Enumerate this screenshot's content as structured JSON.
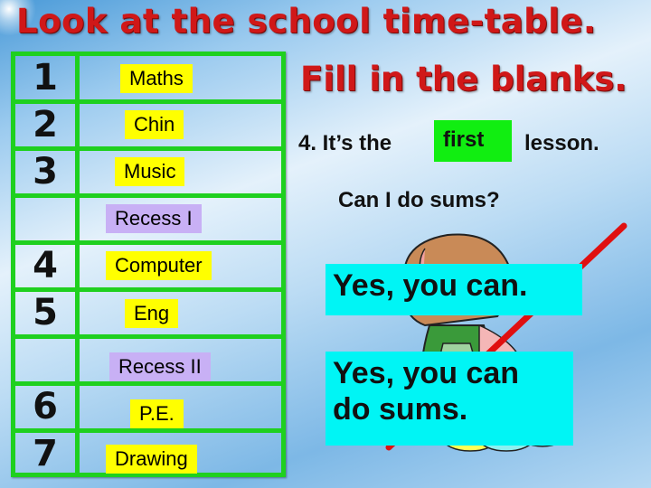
{
  "slide": {
    "title": "Look at the school time-table.",
    "subtitle": "Fill in the blanks."
  },
  "timetable": {
    "rows": [
      {
        "period": "1",
        "subject": "Maths",
        "type": "lesson"
      },
      {
        "period": "2",
        "subject": "Chin",
        "type": "lesson"
      },
      {
        "period": "3",
        "subject": "Music",
        "type": "lesson"
      },
      {
        "period": "",
        "subject": "Recess I",
        "type": "recess"
      },
      {
        "period": "4",
        "subject": "Computer",
        "type": "lesson"
      },
      {
        "period": "5",
        "subject": "Eng",
        "type": "lesson"
      },
      {
        "period": "",
        "subject": "Recess II",
        "type": "recess"
      },
      {
        "period": "6",
        "subject": "P.E.",
        "type": "lesson"
      },
      {
        "period": "7",
        "subject": "Drawing",
        "type": "lesson"
      }
    ]
  },
  "exercise": {
    "prefix": "4. It’s the",
    "blank_answer": "first",
    "suffix": "lesson.",
    "question": "Can I do sums?",
    "answer_short": "Yes, you can.",
    "answer_long_line1": "Yes, you can",
    "answer_long_line2": "do sums."
  },
  "colors": {
    "title": "#d01818",
    "grid": "#1fd01f",
    "lesson_highlight": "#ffff00",
    "recess_highlight": "#c8b0f5",
    "blank_fill": "#11ee11",
    "answer_fill": "#00f5f5"
  }
}
